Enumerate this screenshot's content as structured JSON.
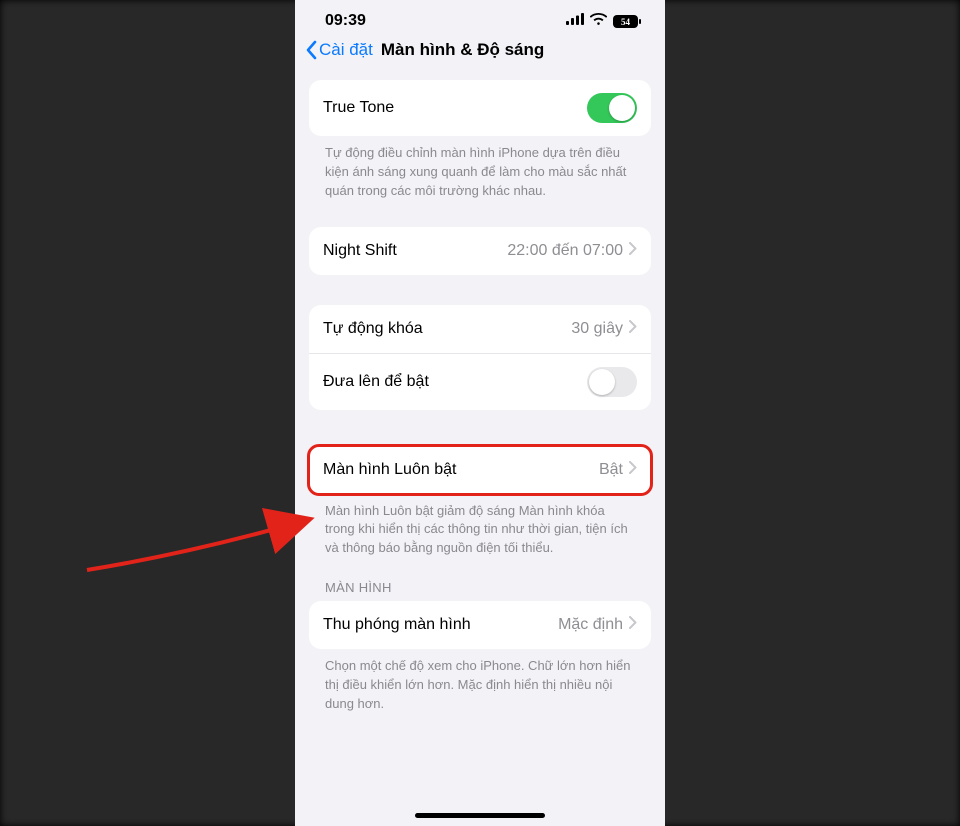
{
  "status": {
    "time": "09:39",
    "battery": "54"
  },
  "nav": {
    "back": "Cài đặt",
    "title": "Màn hình & Độ sáng"
  },
  "trueTone": {
    "label": "True Tone",
    "footer": "Tự động điều chỉnh màn hình iPhone dựa trên điều kiện ánh sáng xung quanh để làm cho màu sắc nhất quán trong các môi trường khác nhau."
  },
  "nightShift": {
    "label": "Night Shift",
    "value": "22:00 đến 07:00"
  },
  "autoLock": {
    "label": "Tự động khóa",
    "value": "30 giây"
  },
  "raiseToWake": {
    "label": "Đưa lên để bật"
  },
  "alwaysOn": {
    "label": "Màn hình Luôn bật",
    "value": "Bật",
    "footer": "Màn hình Luôn bật giảm độ sáng Màn hình khóa trong khi hiển thị các thông tin như thời gian, tiện ích và thông báo bằng nguồn điện tối thiểu."
  },
  "sectionDisplay": "MÀN HÌNH",
  "zoom": {
    "label": "Thu phóng màn hình",
    "value": "Mặc định",
    "footer": "Chọn một chế độ xem cho iPhone. Chữ lớn hơn hiển thị điều khiển lớn hơn. Mặc định hiển thị nhiều nội dung hơn."
  }
}
